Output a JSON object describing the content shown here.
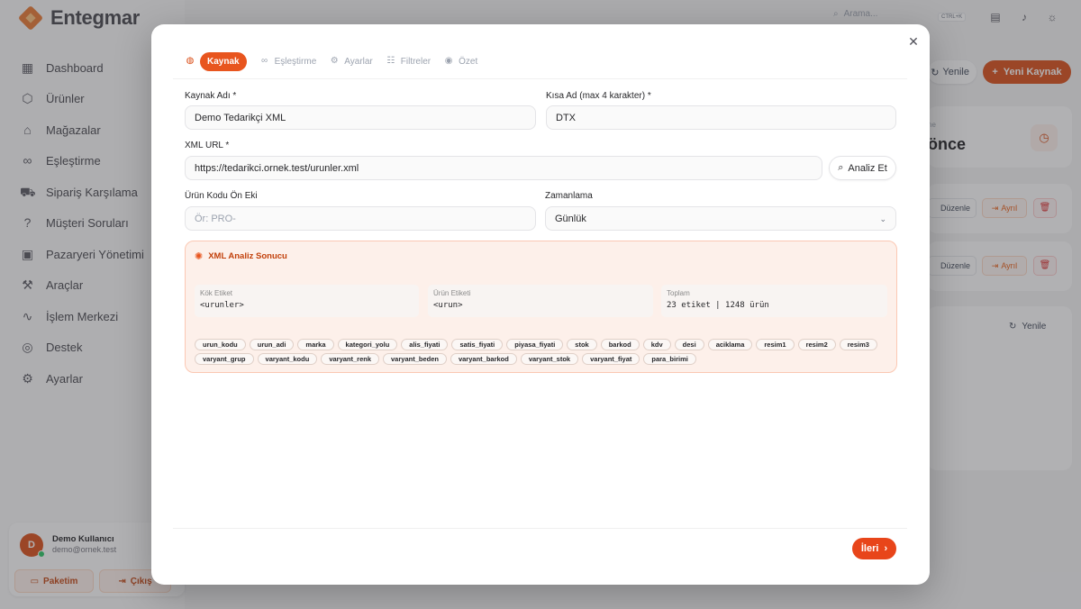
{
  "app": {
    "name": "Entegmar"
  },
  "sidebar": {
    "items": [
      {
        "label": "Dashboard",
        "icon": "grid-icon"
      },
      {
        "label": "Ürünler",
        "icon": "box-icon"
      },
      {
        "label": "Mağazalar",
        "icon": "store-icon"
      },
      {
        "label": "Eşleştirme",
        "icon": "link-icon"
      },
      {
        "label": "Sipariş Karşılama",
        "icon": "truck-icon"
      },
      {
        "label": "Müşteri Soruları",
        "icon": "question-icon"
      },
      {
        "label": "Pazaryeri Yönetimi",
        "icon": "marketplace-icon"
      },
      {
        "label": "Araçlar",
        "icon": "tools-icon"
      },
      {
        "label": "İşlem Merkezi",
        "icon": "activity-icon"
      },
      {
        "label": "Destek",
        "icon": "support-icon"
      },
      {
        "label": "Ayarlar",
        "icon": "gear-icon"
      }
    ],
    "user": {
      "initial": "D",
      "name": "Demo Kullanıcı",
      "email": "demo@ornek.test",
      "package_label": "Paketim",
      "logout_label": "Çıkış"
    }
  },
  "topbar": {
    "search_placeholder": "Arama...",
    "shortcut": "CTRL+K"
  },
  "background": {
    "refresh_label": "Yenile",
    "new_source_label": "Yeni Kaynak",
    "stat_label": "ne",
    "stat_value": "önce",
    "edit_label": "Düzenle",
    "separate_label": "Ayrıl",
    "refresh2_label": "Yenile"
  },
  "modal": {
    "steps": [
      {
        "label": "Kaynak",
        "icon": "globe-icon",
        "active": true
      },
      {
        "label": "Eşleştirme",
        "icon": "link-icon",
        "active": false
      },
      {
        "label": "Ayarlar",
        "icon": "gear-icon",
        "active": false
      },
      {
        "label": "Filtreler",
        "icon": "filter-icon",
        "active": false
      },
      {
        "label": "Özet",
        "icon": "eye-icon",
        "active": false
      }
    ],
    "fields": {
      "source_name": {
        "label": "Kaynak Adı *",
        "value": "Demo Tedarikçi XML"
      },
      "short_name": {
        "label": "Kısa Ad (max 4 karakter) *",
        "value": "DTX"
      },
      "xml_url": {
        "label": "XML URL *",
        "value": "https://tedarikci.ornek.test/urunler.xml"
      },
      "product_prefix": {
        "label": "Ürün Kodu Ön Eki",
        "placeholder": "Ör: PRO-"
      },
      "schedule": {
        "label": "Zamanlama",
        "value": "Günlük"
      }
    },
    "analyze_label": "Analiz Et",
    "result": {
      "title": "XML Analiz Sonucu",
      "root_tag": {
        "label": "Kök Etiket",
        "value": "<urunler>"
      },
      "product_tag": {
        "label": "Ürün Etiketi",
        "value": "<urun>"
      },
      "total": {
        "label": "Toplam",
        "value": "23 etiket | 1248 ürün"
      },
      "tags": [
        "urun_kodu",
        "urun_adi",
        "marka",
        "kategori_yolu",
        "alis_fiyati",
        "satis_fiyati",
        "piyasa_fiyati",
        "stok",
        "barkod",
        "kdv",
        "desi",
        "aciklama",
        "resim1",
        "resim2",
        "resim3",
        "varyant_grup",
        "varyant_kodu",
        "varyant_renk",
        "varyant_beden",
        "varyant_barkod",
        "varyant_stok",
        "varyant_fiyat",
        "para_birimi"
      ]
    },
    "next_label": "İleri"
  },
  "colors": {
    "accent": "#e8451a",
    "brand": "#e8742a"
  }
}
